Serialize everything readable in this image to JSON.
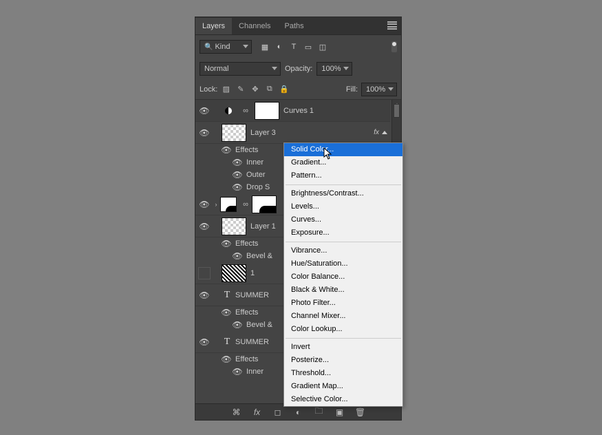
{
  "tabs": {
    "layers": "Layers",
    "channels": "Channels",
    "paths": "Paths"
  },
  "kind": {
    "label": "Kind"
  },
  "blend": {
    "mode": "Normal",
    "opacity_label": "Opacity:",
    "opacity_value": "100%"
  },
  "lock": {
    "label": "Lock:",
    "fill_label": "Fill:",
    "fill_value": "100%"
  },
  "layers": {
    "curves": "Curves 1",
    "layer3": "Layer 3",
    "layer3_effects": "Effects",
    "layer3_fx1": "Inner",
    "layer3_fx2": "Outer",
    "layer3_fx3": "Drop S",
    "group_name": "",
    "layer1": "Layer 1",
    "layer1_effects": "Effects",
    "layer1_fx1": "Bevel &",
    "pattern_name": "1",
    "text1": "SUMMER",
    "text1_effects": "Effects",
    "text1_fx1": "Bevel &",
    "text2": "SUMMER",
    "text2_effects": "Effects",
    "text2_fx1": "Inner",
    "fx_label": "fx"
  },
  "menu": {
    "items": [
      "Solid Color...",
      "Gradient...",
      "Pattern...",
      "Brightness/Contrast...",
      "Levels...",
      "Curves...",
      "Exposure...",
      "Vibrance...",
      "Hue/Saturation...",
      "Color Balance...",
      "Black & White...",
      "Photo Filter...",
      "Channel Mixer...",
      "Color Lookup...",
      "Invert",
      "Posterize...",
      "Threshold...",
      "Gradient Map...",
      "Selective Color..."
    ]
  }
}
